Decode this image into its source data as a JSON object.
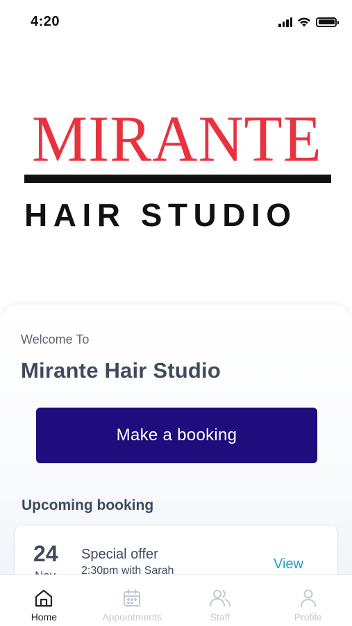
{
  "status_bar": {
    "time": "4:20",
    "icons": [
      "signal-icon",
      "wifi-icon",
      "battery-icon"
    ]
  },
  "logo": {
    "line1": "MIRANTE",
    "line2": "HAIR STUDIO",
    "colors": {
      "primary": "#e8333f",
      "secondary": "#111111"
    }
  },
  "welcome": {
    "label": "Welcome To",
    "studio_name": "Mirante Hair Studio",
    "booking_button": "Make a booking"
  },
  "upcoming": {
    "title": "Upcoming booking",
    "booking": {
      "day": "24",
      "month": "Nov",
      "title": "Special offer",
      "detail": "2:30pm with Sarah",
      "action": "View"
    }
  },
  "tabs": [
    {
      "label": "Home",
      "icon": "home-icon",
      "active": true
    },
    {
      "label": "Appointments",
      "icon": "calendar-icon",
      "active": false
    },
    {
      "label": "Staff",
      "icon": "users-icon",
      "active": false
    },
    {
      "label": "Profile",
      "icon": "user-icon",
      "active": false
    }
  ],
  "colors": {
    "accent": "#1f0c7d",
    "link": "#1fa0c8",
    "text": "#3f4a5c"
  }
}
